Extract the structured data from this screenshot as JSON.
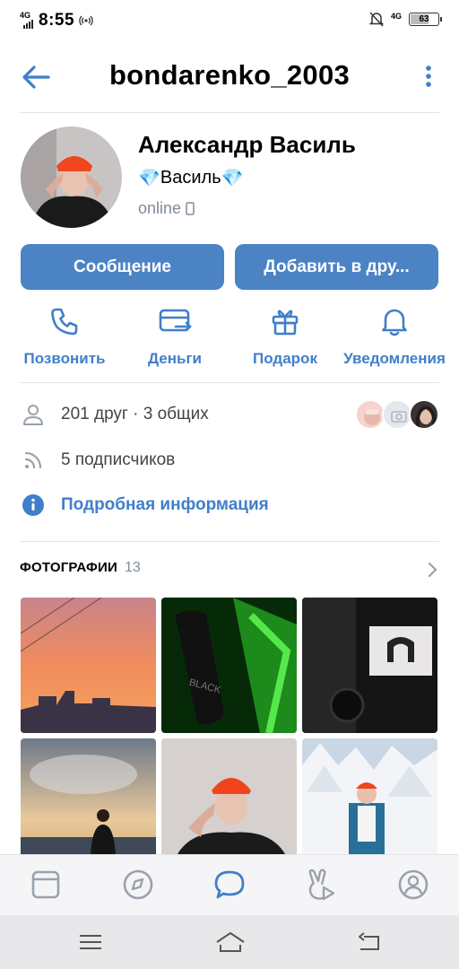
{
  "status_bar": {
    "network_left": "4G",
    "time": "8:55",
    "network_right": "4G",
    "battery": "63"
  },
  "header": {
    "username": "bondarenko_2003"
  },
  "profile": {
    "full_name": "Александр Василь",
    "nickname": "Василь",
    "nickname_emoji": "💎",
    "status": "online"
  },
  "buttons": {
    "message": "Сообщение",
    "add_friend": "Добавить в дру..."
  },
  "actions": [
    {
      "label": "Позвонить",
      "icon": "phone-icon"
    },
    {
      "label": "Деньги",
      "icon": "money-transfer-icon"
    },
    {
      "label": "Подарок",
      "icon": "gift-icon"
    },
    {
      "label": "Уведомления",
      "icon": "bell-icon"
    }
  ],
  "info": {
    "friends": "201 друг · 3 общих",
    "followers": "5 подписчиков",
    "details": "Подробная информация"
  },
  "photos": {
    "title": "ФОТОГРАФИИ",
    "count": "13"
  },
  "colors": {
    "accent": "#4b83c5",
    "link": "#3f7fca",
    "secondary_text": "#818c99",
    "divider": "#e1e3e6"
  },
  "tabs": [
    {
      "name": "news-tab",
      "icon": "feed-icon"
    },
    {
      "name": "discover-tab",
      "icon": "compass-icon"
    },
    {
      "name": "messages-tab",
      "icon": "chat-bubble-icon",
      "active": true
    },
    {
      "name": "clips-tab",
      "icon": "clips-icon"
    },
    {
      "name": "profile-tab",
      "icon": "user-circle-icon"
    }
  ]
}
